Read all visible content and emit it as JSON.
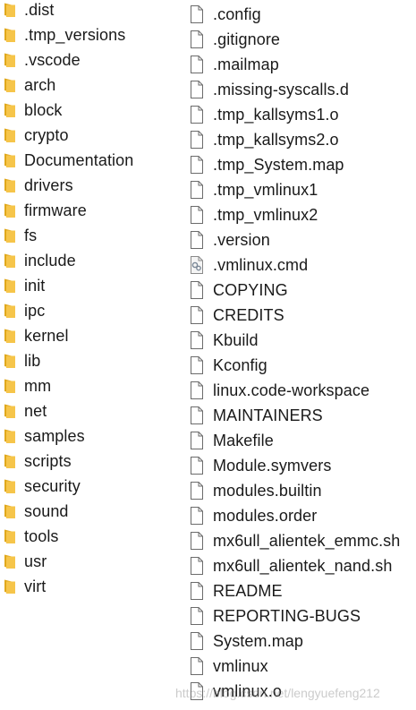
{
  "folders": [
    {
      "name": ".dist",
      "icon": "folder-icon"
    },
    {
      "name": ".tmp_versions",
      "icon": "folder-icon"
    },
    {
      "name": ".vscode",
      "icon": "folder-icon"
    },
    {
      "name": "arch",
      "icon": "folder-icon"
    },
    {
      "name": "block",
      "icon": "folder-icon"
    },
    {
      "name": "crypto",
      "icon": "folder-icon"
    },
    {
      "name": "Documentation",
      "icon": "folder-icon"
    },
    {
      "name": "drivers",
      "icon": "folder-icon"
    },
    {
      "name": "firmware",
      "icon": "folder-icon"
    },
    {
      "name": "fs",
      "icon": "folder-icon"
    },
    {
      "name": "include",
      "icon": "folder-icon"
    },
    {
      "name": "init",
      "icon": "folder-icon"
    },
    {
      "name": "ipc",
      "icon": "folder-icon"
    },
    {
      "name": "kernel",
      "icon": "folder-icon"
    },
    {
      "name": "lib",
      "icon": "folder-icon"
    },
    {
      "name": "mm",
      "icon": "folder-icon"
    },
    {
      "name": "net",
      "icon": "folder-icon"
    },
    {
      "name": "samples",
      "icon": "folder-icon"
    },
    {
      "name": "scripts",
      "icon": "folder-icon"
    },
    {
      "name": "security",
      "icon": "folder-icon"
    },
    {
      "name": "sound",
      "icon": "folder-icon"
    },
    {
      "name": "tools",
      "icon": "folder-icon"
    },
    {
      "name": "usr",
      "icon": "folder-icon"
    },
    {
      "name": "virt",
      "icon": "folder-icon"
    }
  ],
  "files": [
    {
      "name": ".config",
      "icon": "file-icon"
    },
    {
      "name": ".gitignore",
      "icon": "file-icon"
    },
    {
      "name": ".mailmap",
      "icon": "file-icon"
    },
    {
      "name": ".missing-syscalls.d",
      "icon": "file-icon"
    },
    {
      "name": ".tmp_kallsyms1.o",
      "icon": "file-icon"
    },
    {
      "name": ".tmp_kallsyms2.o",
      "icon": "file-icon"
    },
    {
      "name": ".tmp_System.map",
      "icon": "file-icon"
    },
    {
      "name": ".tmp_vmlinux1",
      "icon": "file-icon"
    },
    {
      "name": ".tmp_vmlinux2",
      "icon": "file-icon"
    },
    {
      "name": ".version",
      "icon": "file-icon"
    },
    {
      "name": ".vmlinux.cmd",
      "icon": "cmd-file-icon"
    },
    {
      "name": "COPYING",
      "icon": "file-icon"
    },
    {
      "name": "CREDITS",
      "icon": "file-icon"
    },
    {
      "name": "Kbuild",
      "icon": "file-icon"
    },
    {
      "name": "Kconfig",
      "icon": "file-icon"
    },
    {
      "name": "linux.code-workspace",
      "icon": "file-icon"
    },
    {
      "name": "MAINTAINERS",
      "icon": "file-icon"
    },
    {
      "name": "Makefile",
      "icon": "file-icon"
    },
    {
      "name": "Module.symvers",
      "icon": "file-icon"
    },
    {
      "name": "modules.builtin",
      "icon": "file-icon"
    },
    {
      "name": "modules.order",
      "icon": "file-icon"
    },
    {
      "name": "mx6ull_alientek_emmc.sh",
      "icon": "file-icon"
    },
    {
      "name": "mx6ull_alientek_nand.sh",
      "icon": "file-icon"
    },
    {
      "name": "README",
      "icon": "file-icon"
    },
    {
      "name": "REPORTING-BUGS",
      "icon": "file-icon"
    },
    {
      "name": "System.map",
      "icon": "file-icon"
    },
    {
      "name": "vmlinux",
      "icon": "file-icon"
    },
    {
      "name": "vmlinux.o",
      "icon": "file-icon"
    }
  ],
  "watermark": "https://blog.csdn.net/lengyuefeng212",
  "colors": {
    "folder_back": "#e0a81c",
    "folder_front": "#f6c54a",
    "file_border": "#6b6b6b",
    "file_fill": "#ffffff"
  }
}
